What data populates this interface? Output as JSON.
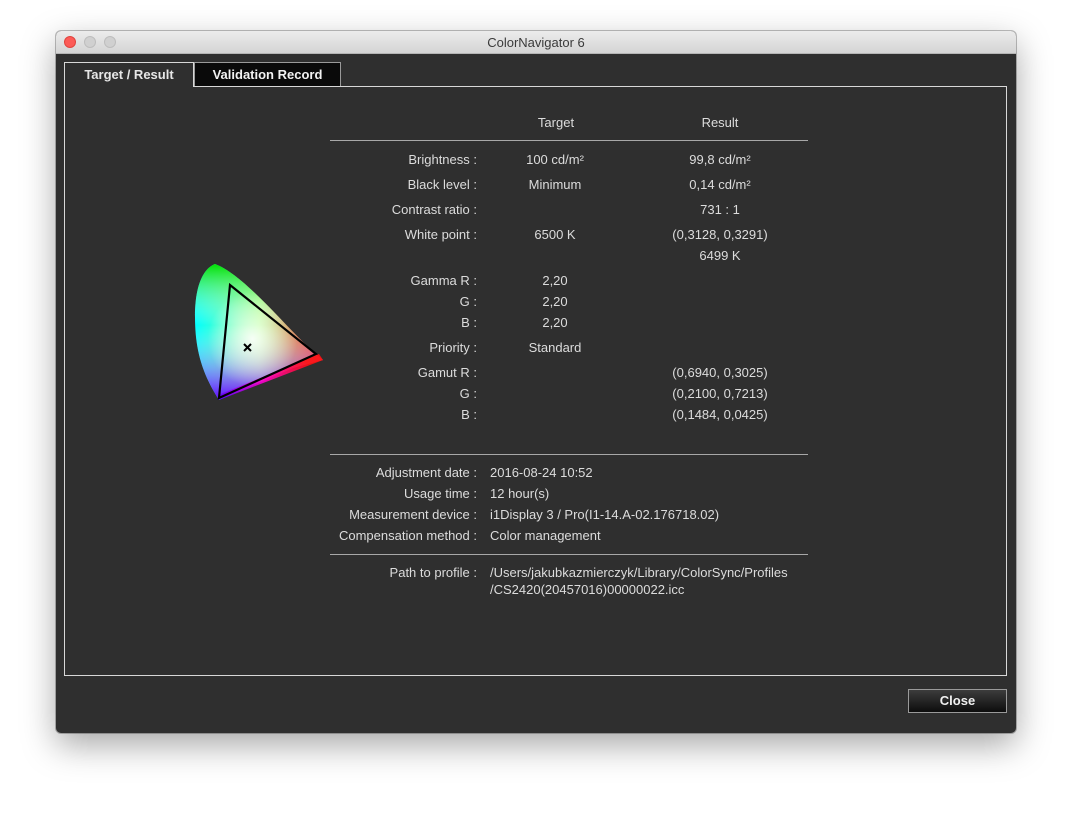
{
  "window": {
    "title": "ColorNavigator 6"
  },
  "tabs": [
    {
      "label": "Target / Result",
      "active": true
    },
    {
      "label": "Validation Record",
      "active": false
    }
  ],
  "table": {
    "header_target": "Target",
    "header_result": "Result",
    "rows": [
      {
        "label": "Brightness :",
        "target": "100 cd/m²",
        "result": "99,8 cd/m²"
      },
      {
        "label": "Black level :",
        "target": "Minimum",
        "result": "0,14 cd/m²"
      },
      {
        "label": "Contrast ratio :",
        "target": "",
        "result": "731 : 1"
      },
      {
        "label": "White point :",
        "target": "6500 K",
        "result": "(0,3128, 0,3291)",
        "result2": "6499 K"
      },
      {
        "label": "Gamma R :",
        "target": "2,20",
        "result": ""
      },
      {
        "label": "G :",
        "target": "2,20",
        "result": ""
      },
      {
        "label": "B :",
        "target": "2,20",
        "result": ""
      },
      {
        "label": "Priority :",
        "target": "Standard",
        "result": ""
      },
      {
        "label": "Gamut R :",
        "target": "",
        "result": "(0,6940, 0,3025)"
      },
      {
        "label": "G :",
        "target": "",
        "result": "(0,2100, 0,7213)"
      },
      {
        "label": "B :",
        "target": "",
        "result": "(0,1484, 0,0425)"
      }
    ]
  },
  "info": [
    {
      "label": "Adjustment date :",
      "value": "2016-08-24 10:52"
    },
    {
      "label": "Usage time :",
      "value": "12 hour(s)"
    },
    {
      "label": "Measurement device :",
      "value": "i1Display 3 / Pro(I1-14.A-02.176718.02)"
    },
    {
      "label": "Compensation method :",
      "value": "Color management"
    }
  ],
  "path": {
    "label": "Path to profile :",
    "line1": "/Users/jakubkazmierczyk/Library/ColorSync/Profiles",
    "line2": "/CS2420(20457016)00000022.icc"
  },
  "buttons": {
    "close_label": "Close"
  },
  "colors": {
    "window_bg": "#2f2f2f",
    "text": "#dcdcdc",
    "close_light": "#fc5b57"
  }
}
